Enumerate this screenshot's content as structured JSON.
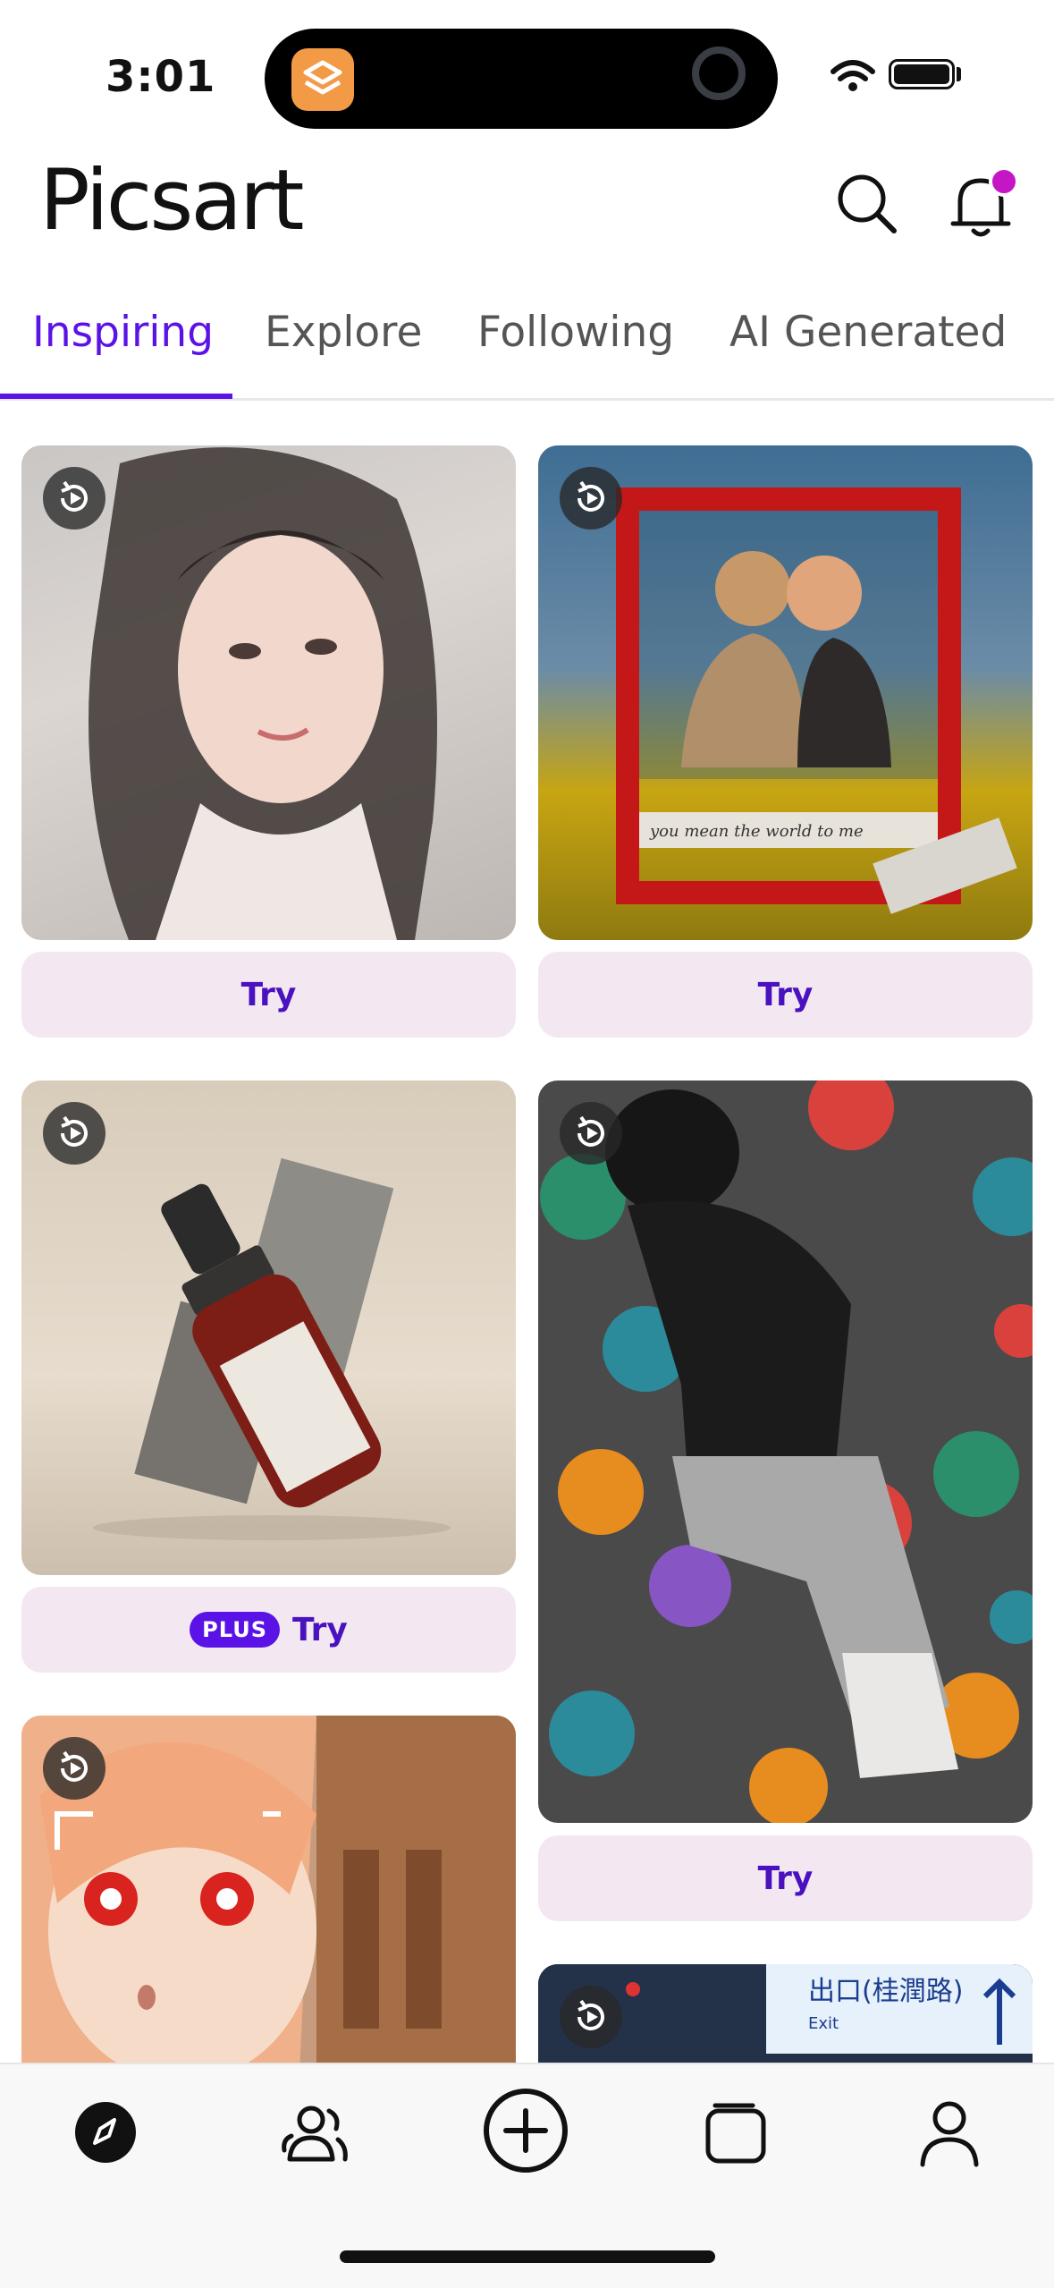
{
  "status_bar": {
    "time": "3:01"
  },
  "header": {
    "logo": "Picsart"
  },
  "tabs": [
    {
      "label": "Inspiring",
      "active": true
    },
    {
      "label": "Explore"
    },
    {
      "label": "Following"
    },
    {
      "label": "AI Generated"
    }
  ],
  "feed": {
    "cards": [
      {
        "subject": "selfie portrait",
        "try_label": "Try"
      },
      {
        "subject": "couple polaroid frame",
        "caption": "you mean the world to me",
        "try_label": "Try"
      },
      {
        "subject": "Nature Organics serum bottle",
        "badge": "PLUS",
        "try_label": "Try"
      },
      {
        "subject": "fashion collage with pom-poms",
        "try_label": "Try"
      },
      {
        "subject": "anime girl with red eyes"
      },
      {
        "subject": "Exit sign",
        "sign_text": "出口(桂潤路)",
        "sign_subtext": "Exit"
      }
    ]
  },
  "bottom_nav": {
    "items": [
      {
        "icon": "compass-icon",
        "active": true
      },
      {
        "icon": "community-icon"
      },
      {
        "icon": "create-icon"
      },
      {
        "icon": "files-icon"
      },
      {
        "icon": "profile-icon"
      }
    ]
  },
  "colors": {
    "accent": "#5a12e6",
    "try_bg": "#f3e8f2",
    "notification": "#c516c5"
  }
}
